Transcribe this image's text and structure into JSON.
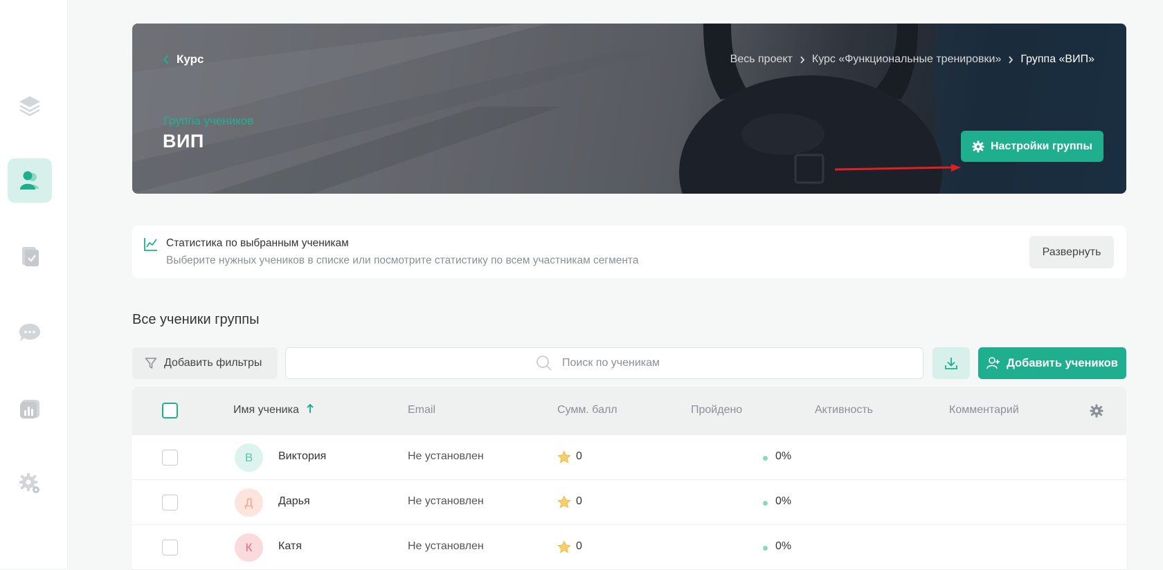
{
  "sidebar": {
    "items": [
      {
        "name": "layers-icon",
        "active": false
      },
      {
        "name": "students-icon",
        "active": true
      },
      {
        "name": "tasks-icon",
        "active": false
      },
      {
        "name": "chat-icon",
        "active": false
      },
      {
        "name": "analytics-icon",
        "active": false
      },
      {
        "name": "settings-icon",
        "active": false
      }
    ]
  },
  "hero": {
    "back_label": "Курс",
    "breadcrumbs": [
      "Весь проект",
      "Курс «Функциональные тренировки»",
      "Группа «ВИП»"
    ],
    "subtitle": "Группа учеников",
    "title": "ВИП",
    "settings_label": "Настройки группы",
    "arrow_color": "#e02020"
  },
  "stats": {
    "title": "Статистика по выбранным ученикам",
    "description": "Выберите нужных учеников в списке или посмотрите статистику по всем участникам сегмента",
    "expand_label": "Развернуть"
  },
  "section_title": "Все ученики группы",
  "toolbar": {
    "filter_label": "Добавить фильтры",
    "search_placeholder": "Поиск по ученикам",
    "add_label": "Добавить учеников"
  },
  "table": {
    "headers": {
      "name": "Имя ученика",
      "email": "Email",
      "score": "Сумм. балл",
      "passed": "Пройдено",
      "activity": "Активность",
      "comment": "Комментарий"
    },
    "rows": [
      {
        "initial": "В",
        "name": "Виктория",
        "email": "Не установлен",
        "score": "0",
        "passed": "0%",
        "avatar_bg": "#dcf3ee",
        "avatar_fg": "#5fc3a9"
      },
      {
        "initial": "Д",
        "name": "Дарья",
        "email": "Не установлен",
        "score": "0",
        "passed": "0%",
        "avatar_bg": "#fde4dc",
        "avatar_fg": "#f0a58c"
      },
      {
        "initial": "К",
        "name": "Катя",
        "email": "Не установлен",
        "score": "0",
        "passed": "0%",
        "avatar_bg": "#fadadd",
        "avatar_fg": "#e06b78"
      }
    ]
  },
  "colors": {
    "accent": "#1fae8e",
    "accent_light": "#d7f1ea"
  }
}
